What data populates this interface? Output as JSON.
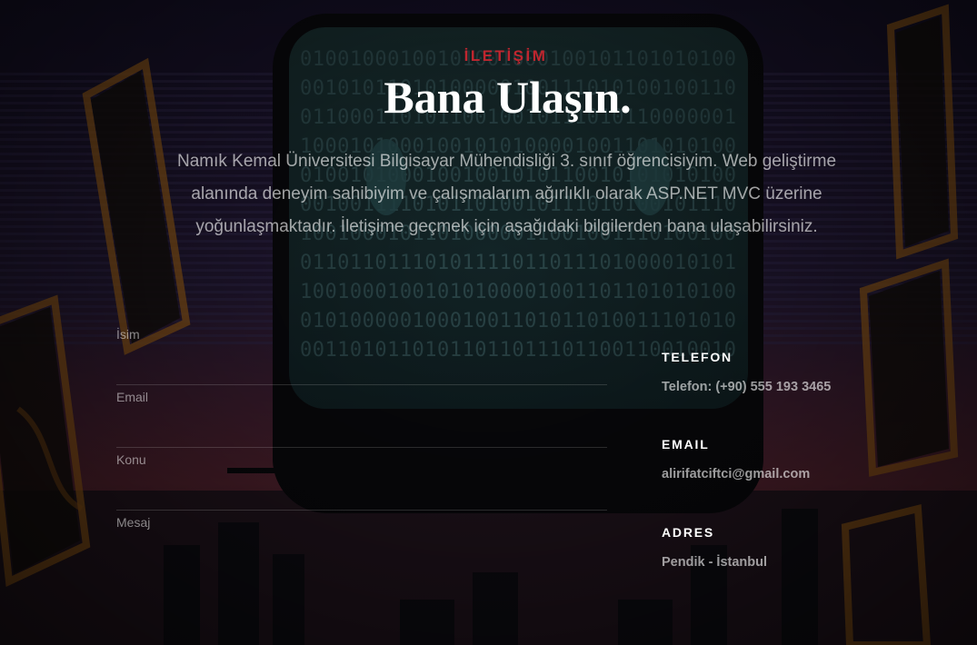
{
  "section": {
    "kicker": "İLETİŞİM",
    "title": "Bana Ulaşın.",
    "description": "Namık Kemal Üniversitesi Bilgisayar Mühendisliği 3. sınıf öğrencisiyim. Web geliştirme alanında deneyim sahibiyim ve çalışmalarım ağırlıklı olarak ASP.NET MVC üzerine yoğunlaşmaktadır. İletişime geçmek için aşağıdaki bilgilerden bana ulaşabilirsiniz."
  },
  "form": {
    "name_placeholder": "İsim",
    "email_placeholder": "Email",
    "subject_placeholder": "Konu",
    "message_placeholder": "Mesaj"
  },
  "contact_info": {
    "phone_label": "TELEFON",
    "phone_value": "Telefon: (+90) 555 193 3465",
    "email_label": "EMAIL",
    "email_value": "alirifatciftci@gmail.com",
    "address_label": "ADRES",
    "address_value": "Pendik - İstanbul"
  },
  "colors": {
    "accent": "#c0262f",
    "heading": "#ffffff",
    "text_muted": "rgba(255,255,255,0.62)",
    "background": "#0c0a12"
  },
  "background_image": {
    "icon": "retro-computer-city-illustration",
    "binary_rows": [
      "01001000100101001000100101101010100",
      "00101011010100000100111010100100110",
      "01100011010110010010111010110000001",
      "10001010001001010100001001101010100",
      "01001010001001001010110010101010100",
      "00100111101011010010111010100101110",
      "10010001011010000011001001110100100",
      "01101101110101111011011101000010101",
      "10010001001010100001001101101010100",
      "01010000010001001101011010011101010",
      "00110101101011011011101100110010010"
    ]
  }
}
